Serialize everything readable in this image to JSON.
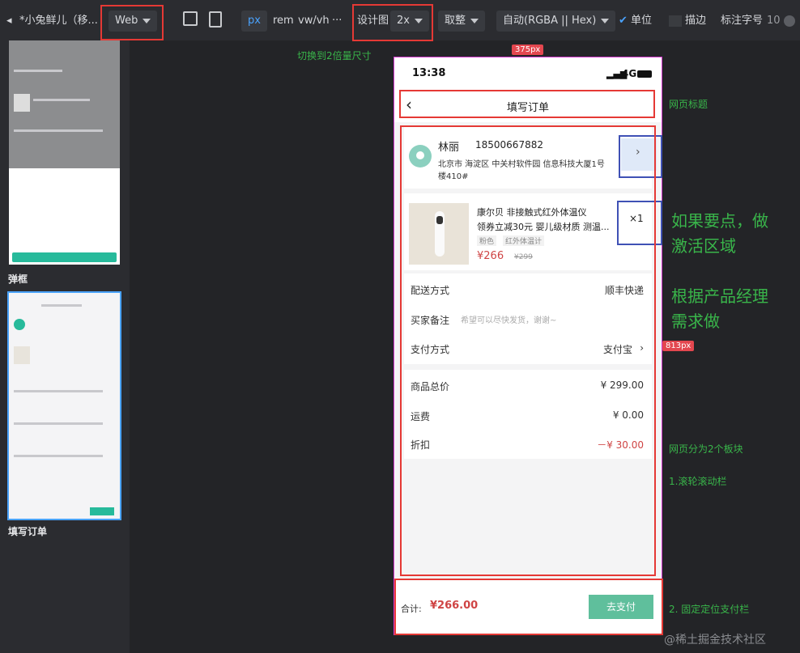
{
  "toolbar": {
    "project": "*小兔鲜儿（移...",
    "platform": "Web",
    "units": [
      "px",
      "rem",
      "vw/vh",
      "···"
    ],
    "design_label": "设计图",
    "design_scale": "2x",
    "rounding": "取整",
    "color_mode": "自动(RGBA || Hex)",
    "unit_label": "单位",
    "stroke_label": "描边",
    "font_label": "标注字号",
    "font_size": "10"
  },
  "left_panel": {
    "pages": [
      {
        "label": "弹框"
      },
      {
        "label": "填写订单"
      }
    ]
  },
  "notes": {
    "switch_size": "切换到2倍量尺寸",
    "width_tag": "375px",
    "height_tag": "813px",
    "page_title_note": "网页标题",
    "hotspot_note_1": "如果要点，做",
    "hotspot_note_2": "激活区域",
    "pm_note_1": "根据产品经理",
    "pm_note_2": "需求做",
    "sections_note": "网页分为2个板块",
    "scroll_note": "1.滚轮滚动栏",
    "fixed_note": "2. 固定定位支付栏",
    "watermark": "@稀土掘金技术社区"
  },
  "phone": {
    "time": "13:38",
    "network": "4G",
    "title": "填写订单",
    "address": {
      "name": "林丽",
      "phone": "18500667882",
      "line1": "北京市  海淀区  中关村软件园   信息科技大厦1号",
      "line2": "楼410#"
    },
    "product": {
      "name_line1": "康尔贝 非接触式红外体温仪",
      "name_line2": "领券立减30元 婴儿级材质 测温...",
      "tag1": "粉色",
      "tag2": "红外体温计",
      "price": "¥266",
      "orig_price": "¥299",
      "qty": "×1"
    },
    "delivery_label": "配送方式",
    "delivery_value": "顺丰快递",
    "remark_label": "买家备注",
    "remark_placeholder": "希望可以尽快发货，谢谢~",
    "payment_label": "支付方式",
    "payment_value": "支付宝",
    "total_label": "商品总价",
    "total_value": "¥ 299.00",
    "shipping_label": "运费",
    "shipping_value": "¥ 0.00",
    "discount_label": "折扣",
    "discount_value": "－¥ 30.00",
    "sum_label": "合计:",
    "sum_value": "¥266.00",
    "pay_button": "去支付"
  },
  "colors": {
    "accent": "#27ba9b",
    "price_red": "#cf4444",
    "annotation_red": "#e53935",
    "annotation_blue": "#3f51b5",
    "note_green": "#39b54a"
  }
}
